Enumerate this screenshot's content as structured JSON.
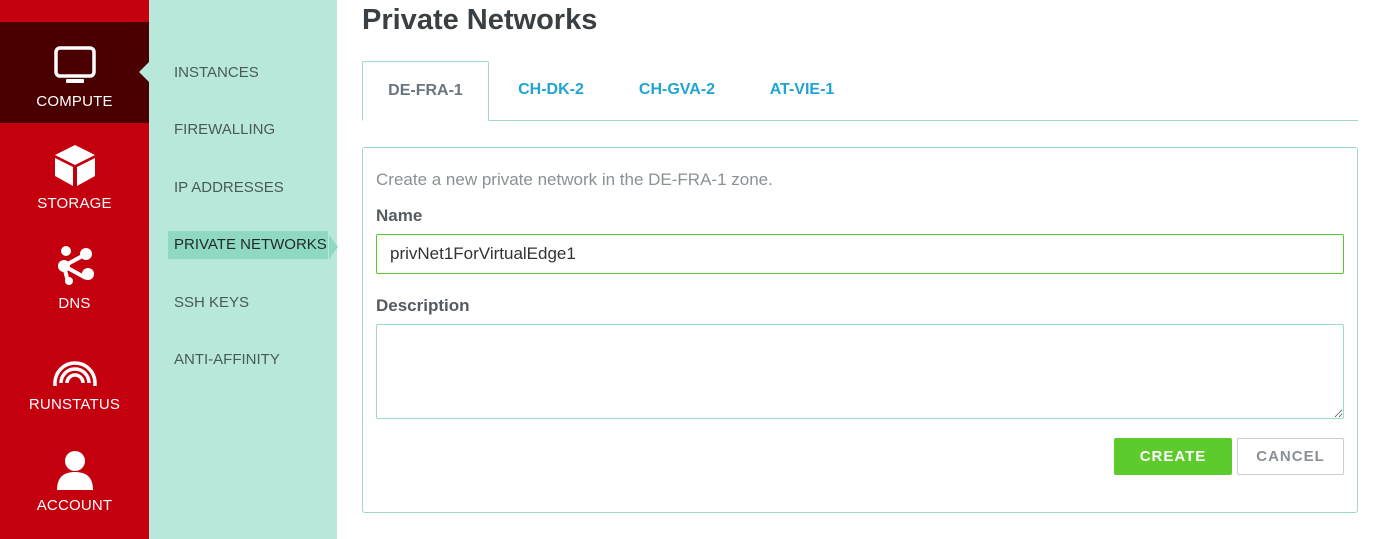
{
  "main_nav": {
    "items": [
      {
        "label": "COMPUTE",
        "icon": "monitor-icon",
        "active": true
      },
      {
        "label": "STORAGE",
        "icon": "cube-icon",
        "active": false
      },
      {
        "label": "DNS",
        "icon": "share-nodes-icon",
        "active": false
      },
      {
        "label": "RUNSTATUS",
        "icon": "signal-icon",
        "active": false
      },
      {
        "label": "ACCOUNT",
        "icon": "user-icon",
        "active": false
      }
    ]
  },
  "sub_nav": {
    "items": [
      {
        "label": "INSTANCES"
      },
      {
        "label": "FIREWALLING"
      },
      {
        "label": "IP ADDRESSES"
      },
      {
        "label": "PRIVATE NETWORKS",
        "active": true
      },
      {
        "label": "SSH KEYS"
      },
      {
        "label": "ANTI-AFFINITY"
      }
    ]
  },
  "page": {
    "title": "Private Networks"
  },
  "tabs": [
    {
      "label": "DE-FRA-1",
      "active": true
    },
    {
      "label": "CH-DK-2"
    },
    {
      "label": "CH-GVA-2"
    },
    {
      "label": "AT-VIE-1"
    }
  ],
  "form": {
    "intro": "Create a new private network in the DE-FRA-1 zone.",
    "name_label": "Name",
    "name_value": "privNet1ForVirtualEdge1",
    "description_label": "Description",
    "description_value": "",
    "create_label": "CREATE",
    "cancel_label": "CANCEL"
  },
  "colors": {
    "brand_red": "#c4000f",
    "active_dark": "#4a0000",
    "mint": "#b8e8dc",
    "mint_active": "#8fd8c4",
    "tab_link": "#1fa4d3",
    "create_green": "#5dcb2b"
  }
}
